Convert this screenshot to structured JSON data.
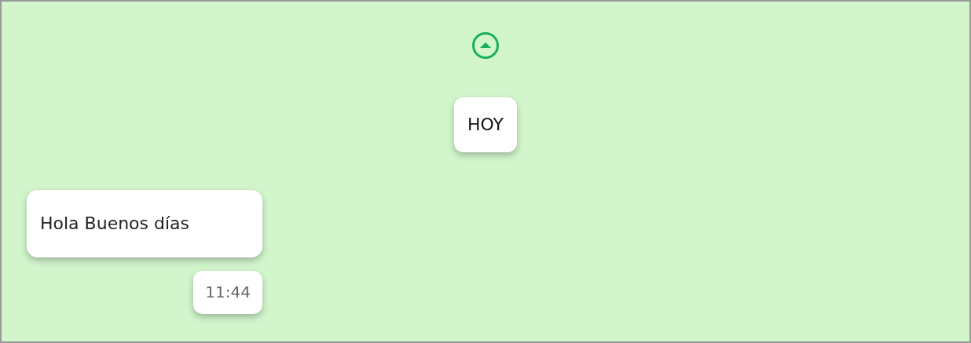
{
  "date_separator": "HOY",
  "messages": [
    {
      "kind": "incoming",
      "text": "Hola Buenos días",
      "time": "11:44"
    }
  ]
}
